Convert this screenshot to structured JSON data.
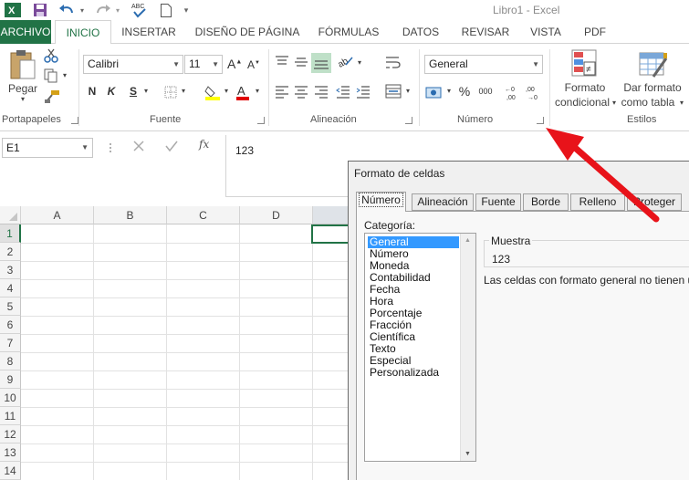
{
  "window": {
    "title": "Libro1 - Excel"
  },
  "tabs": [
    {
      "label": "ARCHIVO"
    },
    {
      "label": "INICIO"
    },
    {
      "label": "INSERTAR"
    },
    {
      "label": "DISEÑO DE PÁGINA"
    },
    {
      "label": "FÓRMULAS"
    },
    {
      "label": "DATOS"
    },
    {
      "label": "REVISAR"
    },
    {
      "label": "VISTA"
    },
    {
      "label": "PDF"
    }
  ],
  "ribbon": {
    "portapapeles": {
      "label": "Portapapeles",
      "paste_label": "Pegar"
    },
    "fuente": {
      "label": "Fuente",
      "font_name": "Calibri",
      "font_size": "11",
      "bold": "N",
      "italic": "K",
      "underline": "S"
    },
    "alineacion": {
      "label": "Alineación"
    },
    "numero": {
      "label": "Número",
      "format": "General",
      "percent": "%",
      "thousands": "000"
    },
    "estilos": {
      "label": "Estilos",
      "cond_format_1": "Formato",
      "cond_format_2": "condicional",
      "table_format_1": "Dar formato",
      "table_format_2": "como tabla"
    }
  },
  "formula_bar": {
    "name_box": "E1",
    "value": "123",
    "fx": "fx"
  },
  "grid": {
    "columns": [
      "A",
      "B",
      "C",
      "D"
    ],
    "rows": [
      "1",
      "2",
      "3",
      "4",
      "5",
      "6",
      "7",
      "8",
      "9",
      "10",
      "11",
      "12",
      "13",
      "14"
    ]
  },
  "dialog": {
    "title": "Formato de celdas",
    "tabs": [
      "Número",
      "Alineación",
      "Fuente",
      "Borde",
      "Relleno",
      "Proteger"
    ],
    "category_label": "Categoría:",
    "categories": [
      "General",
      "Número",
      "Moneda",
      "Contabilidad",
      "Fecha",
      "Hora",
      "Porcentaje",
      "Fracción",
      "Científica",
      "Texto",
      "Especial",
      "Personalizada"
    ],
    "selected_category": "General",
    "sample_label": "Muestra",
    "sample_value": "123",
    "description": "Las celdas con formato general no tienen un"
  },
  "colors": {
    "excel_green": "#217346",
    "arrow_red": "#e8131a",
    "selection_blue": "#3399ff"
  }
}
